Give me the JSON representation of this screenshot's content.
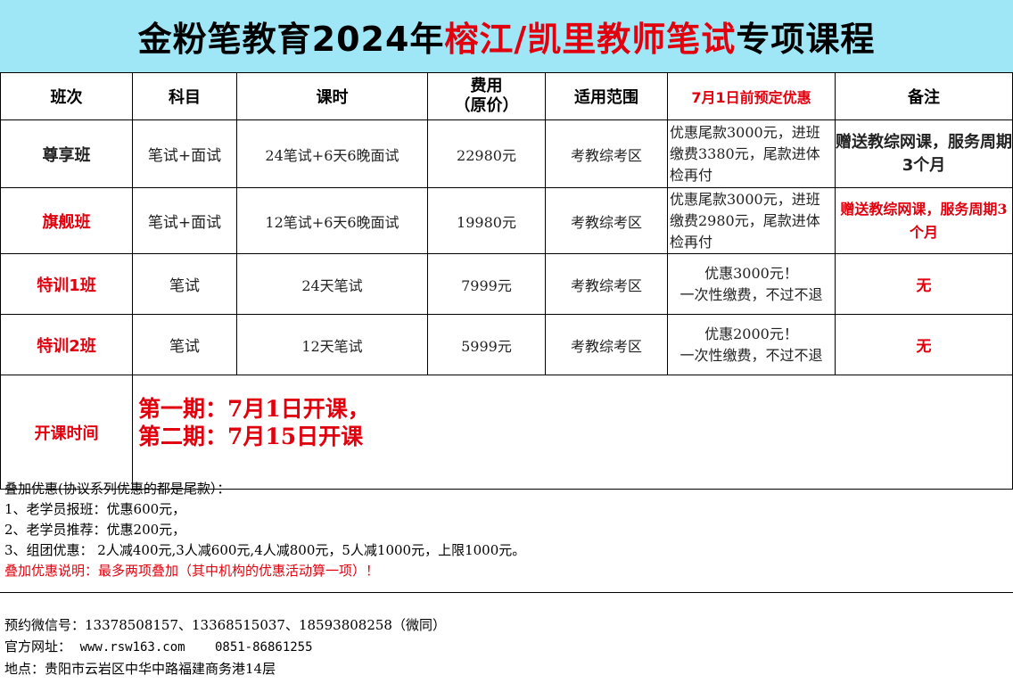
{
  "title": {
    "prefix": "金粉笔教育2024年",
    "highlight": "榕江/凯里教师笔试",
    "suffix": "专项课程"
  },
  "headers": {
    "class": "班次",
    "subject": "科目",
    "hours": "课时",
    "fee_line1": "费用",
    "fee_line2": "（原价）",
    "scope": "适用范围",
    "presale": "7月1日前预定优惠",
    "remark": "备注"
  },
  "rows": [
    {
      "class": "尊享班",
      "subject": "笔试+面试",
      "hours": "24笔试+6天6晚面试",
      "fee": "22980元",
      "scope": "考教综考区",
      "discount": "优惠尾款3000元，进班缴费3380元，尾款进体检再付",
      "remark": "赠送教综网课，服务周期3个月"
    },
    {
      "class": "旗舰班",
      "subject": "笔试+面试",
      "hours": "12笔试+6天6晚面试",
      "fee": "19980元",
      "scope": "考教综考区",
      "discount": "优惠尾款3000元，进班缴费2980元，尾款进体检再付",
      "remark": "赠送教综网课，服务周期3个月"
    },
    {
      "class": "特训1班",
      "subject": "笔试",
      "hours": "24天笔试",
      "fee": "7999元",
      "scope": "考教综考区",
      "discount_line1": "优惠3000元！",
      "discount_line2": "一次性缴费，不过不退",
      "remark": "无"
    },
    {
      "class": "特训2班",
      "subject": "笔试",
      "hours": "12天笔试",
      "fee": "5999元",
      "scope": "考教综考区",
      "discount_line1": "优惠2000元！",
      "discount_line2": "一次性缴费，不过不退",
      "remark": "无"
    }
  ],
  "schedule": {
    "label": "开课时间",
    "line1": "第一期：7月1日开课，",
    "line2": "第二期：7月15日开课"
  },
  "extra": {
    "heading": "叠加优惠(协议系列优惠的都是尾款）：",
    "items": [
      "1、老学员报班：优惠600元，",
      "2、老学员推荐：优惠200元，",
      "3、组团优惠： 2人减400元,3人减600元,4人减800元，5人减1000元，上限1000元。"
    ],
    "note": "叠加优惠说明：最多两项叠加（其中机构的优惠活动算一项）！"
  },
  "contact": {
    "wechat_label": "预约微信号：",
    "wechat": "13378508157、13368515037、18593808258（微同）",
    "site_label": "官方网址：",
    "site": "www.rsw163.com",
    "phone": "0851-86861255",
    "address_label": "地点：",
    "address": "贵阳市云岩区中华中路福建商务港14层"
  },
  "colors": {
    "title_bg": "#9fe6f6",
    "accent_red": "#e0000e"
  }
}
